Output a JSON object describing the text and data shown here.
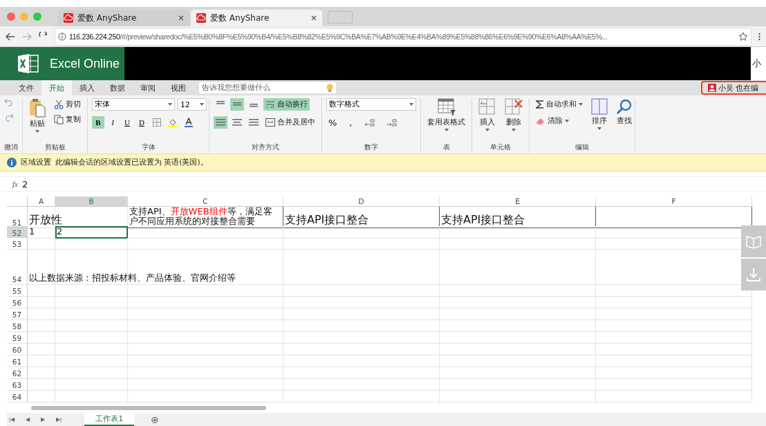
{
  "browser": {
    "tabs": [
      {
        "title": "爱数 AnyShare",
        "selected": false
      },
      {
        "title": "爱数 AnyShare",
        "selected": true
      }
    ],
    "url_host": "116.236.224.250",
    "url_path": "/#/preview/sharedoc/%E5%B0%8F%E5%90%B4/%E5%B8%82%E5%9C%BA%E7%AB%9E%E4%BA%89%E5%88%86%E6%9E%90%E6%A8%AA%E5%..."
  },
  "app": {
    "title": "Excel Online",
    "user": "小"
  },
  "ribbon_tabs": [
    {
      "label": "文件",
      "selected": false
    },
    {
      "label": "开始",
      "selected": true
    },
    {
      "label": "插入",
      "selected": false
    },
    {
      "label": "数据",
      "selected": false
    },
    {
      "label": "审阅",
      "selected": false
    },
    {
      "label": "视图",
      "selected": false
    }
  ],
  "search": {
    "placeholder": "告诉我您想要做什么"
  },
  "coauthor": "小吴 也在编",
  "ribbon": {
    "undo_group": "撤消",
    "clipboard": {
      "label": "剪贴板",
      "paste": "粘贴",
      "items": [
        "剪切",
        "复制"
      ]
    },
    "font": {
      "label": "字体",
      "name": "宋体",
      "size": "12",
      "buttons": [
        {
          "label": "B",
          "selected": true
        },
        {
          "label": "I",
          "selected": false
        },
        {
          "label": "U",
          "selected": false
        },
        {
          "label": "D",
          "selected": false
        }
      ]
    },
    "alignment": {
      "label": "对齐方式",
      "vertical": [
        {
          "selected": false
        },
        {
          "selected": true
        },
        {
          "selected": false
        }
      ],
      "horizontal": [
        {
          "selected": true
        },
        {
          "selected": false
        },
        {
          "selected": false
        }
      ],
      "wrap": {
        "label": "自动换行",
        "selected": true
      },
      "merge": "合并及居中"
    },
    "number": {
      "label": "数字",
      "format": "数字格式",
      "buttons": [
        "%",
        ","
      ]
    },
    "table": {
      "label": "表",
      "button": "套用表格式"
    },
    "cells": {
      "label": "单元格",
      "buttons": [
        "插入",
        "删除"
      ]
    },
    "editing": {
      "label": "编辑",
      "autosum": "自动求和",
      "clear": "清除",
      "sort": "排序",
      "find": "查找"
    }
  },
  "info_bar": {
    "title": "区域设置",
    "message": "此编辑会话的区域设置已设置为 英语(美国)。"
  },
  "formula": {
    "label": "fx",
    "value": "2"
  },
  "columns": [
    {
      "label": "A",
      "selected": false
    },
    {
      "label": "B",
      "selected": true
    },
    {
      "label": "C",
      "selected": false
    },
    {
      "label": "D",
      "selected": false
    },
    {
      "label": "E",
      "selected": false
    },
    {
      "label": "F",
      "selected": false
    }
  ],
  "rows": [
    {
      "number": "51",
      "selected": false,
      "cells": [
        {
          "text": "开放性"
        },
        null,
        {
          "segments": [
            {
              "text": "支持API、"
            },
            {
              "text": "开放WEB组件",
              "color": "#ff0000"
            },
            {
              "text": "等，满足客"
            },
            {
              "text": "户不同应用系统的对接整合需要"
            }
          ]
        },
        {
          "text": "支持API接口整合"
        },
        {
          "text": "支持API接口整合"
        },
        null
      ]
    },
    {
      "number": "52",
      "selected": true,
      "cells": [
        {
          "text": "1"
        },
        {
          "text": "2",
          "active": true
        },
        null,
        null,
        null,
        null
      ]
    },
    {
      "number": "53",
      "selected": false,
      "cells": [
        null,
        null,
        null,
        null,
        null,
        null
      ]
    },
    {
      "number": "54",
      "selected": false,
      "cells": [
        {
          "text": "以上数据来源：招投标材料、产品体验、官网介绍等"
        },
        null,
        null,
        null,
        null,
        null
      ]
    },
    {
      "number": "55",
      "selected": false,
      "cells": [
        null,
        null,
        null,
        null,
        null,
        null
      ]
    },
    {
      "number": "56",
      "selected": false,
      "cells": [
        null,
        null,
        null,
        null,
        null,
        null
      ]
    },
    {
      "number": "57",
      "selected": false,
      "cells": [
        null,
        null,
        null,
        null,
        null,
        null
      ]
    },
    {
      "number": "58",
      "selected": false,
      "cells": [
        null,
        null,
        null,
        null,
        null,
        null
      ]
    },
    {
      "number": "59",
      "selected": false,
      "cells": [
        null,
        null,
        null,
        null,
        null,
        null
      ]
    },
    {
      "number": "60",
      "selected": false,
      "cells": [
        null,
        null,
        null,
        null,
        null,
        null
      ]
    },
    {
      "number": "61",
      "selected": false,
      "cells": [
        null,
        null,
        null,
        null,
        null,
        null
      ]
    },
    {
      "number": "62",
      "selected": false,
      "cells": [
        null,
        null,
        null,
        null,
        null,
        null
      ]
    },
    {
      "number": "63",
      "selected": false,
      "cells": [
        null,
        null,
        null,
        null,
        null,
        null
      ]
    },
    {
      "number": "64",
      "selected": false,
      "cells": [
        null,
        null,
        null,
        null,
        null,
        null
      ]
    }
  ],
  "sheet_tabs": [
    {
      "label": "工作表1",
      "selected": true
    }
  ],
  "sheet_nav": [
    "|◀",
    "◀",
    "▶",
    "▶|"
  ],
  "add_sheet": "⊕"
}
